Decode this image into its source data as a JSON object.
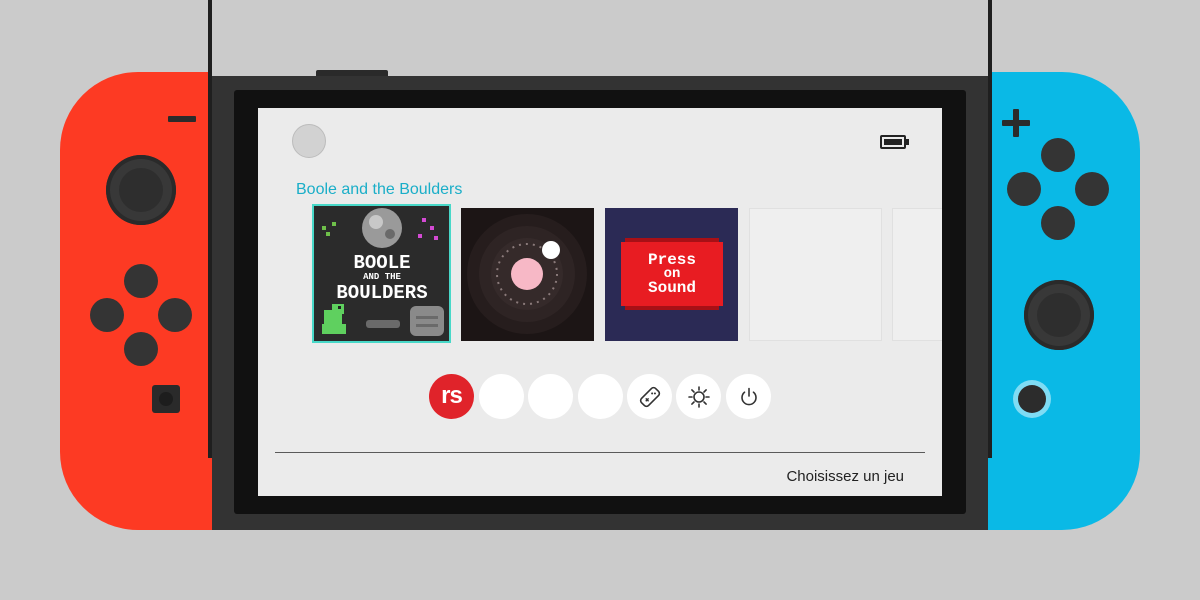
{
  "header": {
    "avatar": "user-avatar",
    "battery": "battery-icon"
  },
  "selected_game": {
    "title": "Boole and the Boulders"
  },
  "games": [
    {
      "art_lines": [
        "BOOLE",
        "AND THE",
        "BOULDERS"
      ]
    },
    {
      "art": "orbit-artwork"
    },
    {
      "art_lines": [
        "Press",
        "on",
        "Sound"
      ]
    },
    {
      "art": "empty-slot"
    },
    {
      "art": "empty-slot"
    }
  ],
  "shortcuts": [
    {
      "label": "rs",
      "color": "#e0232a"
    },
    {
      "icon": "blank"
    },
    {
      "icon": "blank"
    },
    {
      "icon": "blank"
    },
    {
      "icon": "controller-icon"
    },
    {
      "icon": "gear-icon"
    },
    {
      "icon": "power-icon"
    }
  ],
  "footer": {
    "hint": "Choisissez un jeu"
  },
  "colors": {
    "left_joycon": "#fd3a23",
    "right_joycon": "#0ab9e6",
    "accent": "#1aaec8",
    "selection": "#48d8c8"
  }
}
